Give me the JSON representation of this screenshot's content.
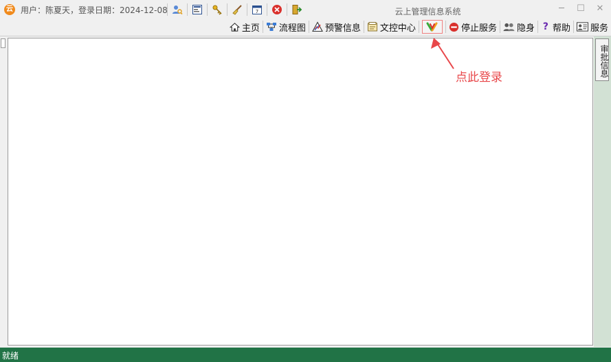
{
  "app_title": "云上管理信息系统",
  "logo_text": "云",
  "user_info": "用户：陈夏天，登录日期：2024-12-08",
  "quick_tools": [
    {
      "icon": "user-search-icon"
    },
    {
      "icon": "form-icon"
    },
    {
      "icon": "key-icon"
    },
    {
      "icon": "broom-icon"
    },
    {
      "icon": "calendar-icon"
    },
    {
      "icon": "close-circle-icon"
    },
    {
      "icon": "exit-icon"
    }
  ],
  "window_controls": {
    "minimize": "─",
    "maximize": "☐",
    "close": "✕"
  },
  "toolbar": {
    "home": "主页",
    "flowchart": "流程图",
    "warning": "预警信息",
    "doc_center": "文控中心",
    "stop_service": "停止服务",
    "hide": "隐身",
    "help": "帮助",
    "service": "服务"
  },
  "right_tab": "审批信息",
  "annotation": "点此登录",
  "status": "就绪",
  "colors": {
    "status_bar": "#217346",
    "annotation": "#e8474a",
    "side_panel": "#d2e1d4"
  }
}
